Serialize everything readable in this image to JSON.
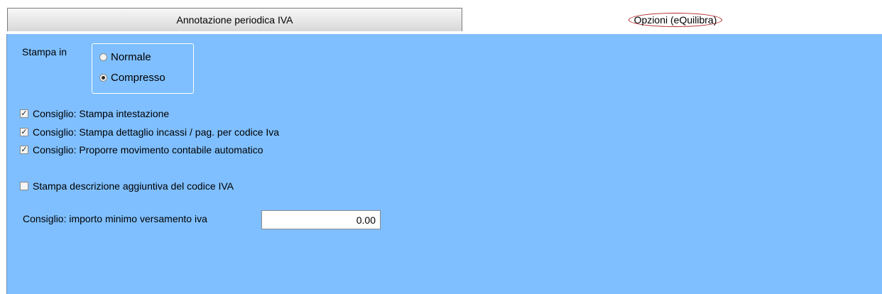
{
  "tabs": {
    "active_label": "Annotazione periodica IVA",
    "options_label": "Opzioni (eQuilibra)"
  },
  "stampa": {
    "label": "Stampa in",
    "options": [
      {
        "label": "Normale",
        "selected": false
      },
      {
        "label": "Compresso",
        "selected": true
      }
    ]
  },
  "checks": [
    {
      "label": "Consiglio: Stampa intestazione",
      "checked": true
    },
    {
      "label": "Consiglio: Stampa dettaglio incassi / pag. per codice Iva",
      "checked": true
    },
    {
      "label": "Consiglio: Proporre movimento contabile automatico",
      "checked": true
    },
    {
      "label": "Stampa descrizione aggiuntiva del codice IVA",
      "checked": false
    }
  ],
  "importo": {
    "label": "Consiglio: importo minimo versamento iva",
    "value": "0.00"
  },
  "colors": {
    "panel_bg": "#7fbfff",
    "highlight_outline": "#b22020"
  }
}
